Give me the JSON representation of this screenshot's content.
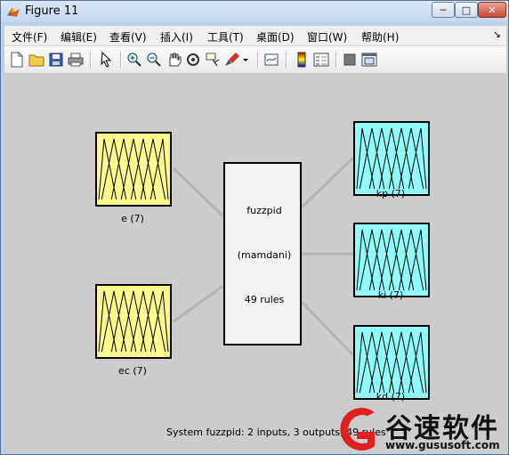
{
  "window": {
    "title": "Figure 11",
    "buttons": {
      "minimize": "─",
      "maximize": "□",
      "close": "✕"
    }
  },
  "menubar": {
    "items": [
      "文件(F)",
      "编辑(E)",
      "查看(V)",
      "插入(I)",
      "工具(T)",
      "桌面(D)",
      "窗口(W)",
      "帮助(H)"
    ],
    "restore_glyph": "↘"
  },
  "toolbar": {
    "icons": [
      "new-figure-icon",
      "open-file-icon",
      "save-icon",
      "print-icon",
      "pointer-icon",
      "zoom-in-icon",
      "zoom-out-icon",
      "pan-hand-icon",
      "rotate-3d-icon",
      "data-cursor-icon",
      "brush-icon",
      "brush-dropdown-icon",
      "link-plot-icon",
      "colorbar-icon",
      "legend-icon",
      "hide-plot-tools-icon",
      "show-plot-tools-icon"
    ]
  },
  "fis": {
    "inputs": [
      {
        "name": "e",
        "label": "e (7)",
        "mf_count": 7,
        "color": "#fdfa8d"
      },
      {
        "name": "ec",
        "label": "ec (7)",
        "mf_count": 7,
        "color": "#fdfa8d"
      }
    ],
    "outputs": [
      {
        "name": "kp",
        "label": "kp (7)",
        "mf_count": 7,
        "color": "#8ffbfb"
      },
      {
        "name": "ki",
        "label": "ki (7)",
        "mf_count": 7,
        "color": "#8ffbfb"
      },
      {
        "name": "kd",
        "label": "kd (7)",
        "mf_count": 7,
        "color": "#8ffbfb"
      }
    ],
    "system": {
      "name": "fuzzpid",
      "type": "(mamdani)",
      "rules": "49 rules"
    },
    "status": "System fuzzpid: 2 inputs, 3 outputs, 49 rules"
  },
  "watermark": {
    "brand": "谷速软件",
    "url": "www.gususoft.com"
  },
  "colors": {
    "canvas": "#cccccc",
    "input_fill": "#fdfa8d",
    "output_fill": "#8ffbfb",
    "center_fill": "#f3f3f3",
    "watermark_red": "#e02020"
  }
}
